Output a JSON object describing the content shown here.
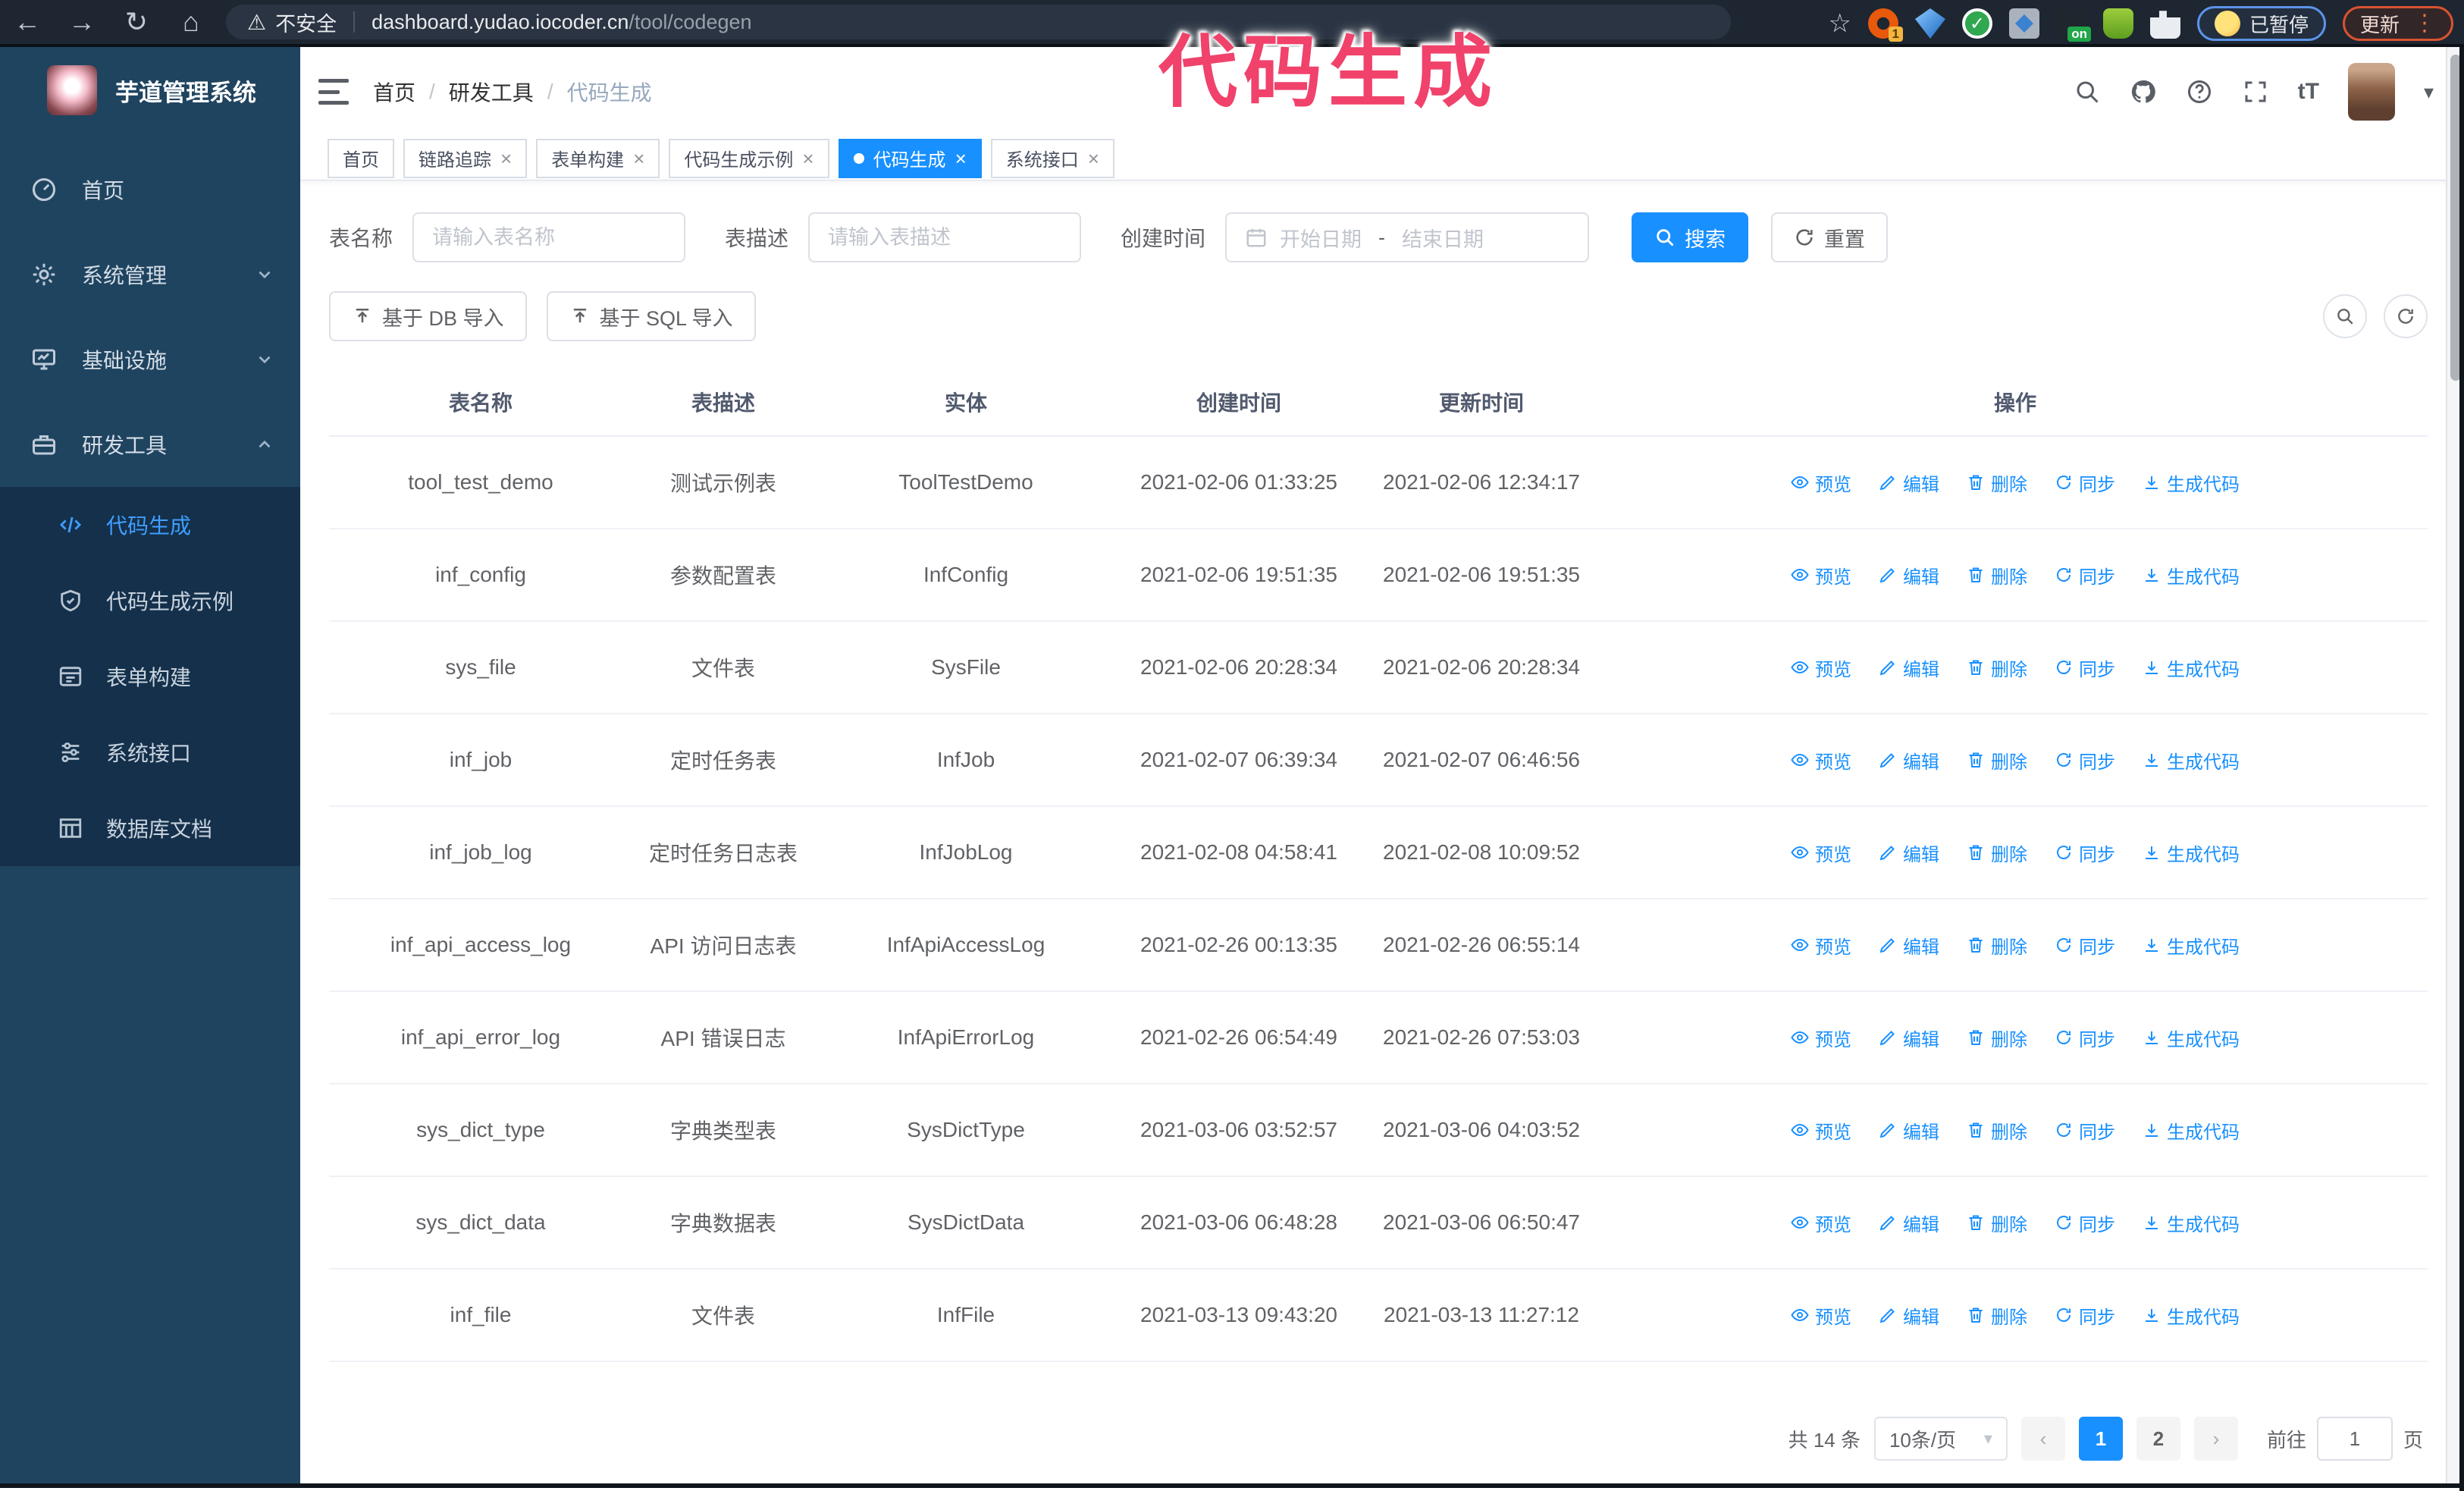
{
  "overlay": {
    "text": "代码生成",
    "color": "#f0426b"
  },
  "browser": {
    "insecure_label": "不安全",
    "url_host": "dashboard.yudao.iocoder.cn",
    "url_path": "/tool/codegen",
    "ext1_badge": "1",
    "ext5_badge": "on",
    "paused_label": "已暂停",
    "update_label": "更新"
  },
  "colors": {
    "primary": "#1890ff",
    "sidebar_bg": "#1f4460",
    "submenu_bg": "#14304b",
    "active_link": "#409eff"
  },
  "sidebar": {
    "title": "芋道管理系统",
    "items": [
      {
        "label": "首页",
        "icon": "dashboard-icon"
      },
      {
        "label": "系统管理",
        "icon": "gear-icon",
        "chevron": "down"
      },
      {
        "label": "基础设施",
        "icon": "monitor-icon",
        "chevron": "down"
      },
      {
        "label": "研发工具",
        "icon": "briefcase-icon",
        "chevron": "up"
      }
    ],
    "submenu": [
      {
        "label": "代码生成",
        "icon": "code-icon",
        "active": true
      },
      {
        "label": "代码生成示例",
        "icon": "shield-icon",
        "active": false
      },
      {
        "label": "表单构建",
        "icon": "form-icon",
        "active": false
      },
      {
        "label": "系统接口",
        "icon": "sliders-icon",
        "active": false
      },
      {
        "label": "数据库文档",
        "icon": "database-icon",
        "active": false
      }
    ]
  },
  "header": {
    "breadcrumb": [
      "首页",
      "研发工具",
      "代码生成"
    ]
  },
  "tabs": [
    {
      "label": "首页",
      "closable": false,
      "active": false
    },
    {
      "label": "链路追踪",
      "closable": true,
      "active": false
    },
    {
      "label": "表单构建",
      "closable": true,
      "active": false
    },
    {
      "label": "代码生成示例",
      "closable": true,
      "active": false
    },
    {
      "label": "代码生成",
      "closable": true,
      "active": true
    },
    {
      "label": "系统接口",
      "closable": true,
      "active": false
    }
  ],
  "filters": {
    "name_label": "表名称",
    "name_placeholder": "请输入表名称",
    "desc_label": "表描述",
    "desc_placeholder": "请输入表描述",
    "time_label": "创建时间",
    "start_placeholder": "开始日期",
    "range_separator": "-",
    "end_placeholder": "结束日期",
    "search_label": "搜索",
    "reset_label": "重置"
  },
  "toolbar": {
    "db_import_label": "基于 DB 导入",
    "sql_import_label": "基于 SQL 导入"
  },
  "table": {
    "columns": [
      "表名称",
      "表描述",
      "实体",
      "创建时间",
      "更新时间",
      "操作"
    ],
    "row_actions": [
      {
        "key": "preview",
        "label": "预览"
      },
      {
        "key": "edit",
        "label": "编辑"
      },
      {
        "key": "delete",
        "label": "删除"
      },
      {
        "key": "sync",
        "label": "同步"
      },
      {
        "key": "generate",
        "label": "生成代码"
      }
    ],
    "rows": [
      {
        "name": "tool_test_demo",
        "desc": "测试示例表",
        "entity": "ToolTestDemo",
        "created": "2021-02-06 01:33:25",
        "updated": "2021-02-06 12:34:17"
      },
      {
        "name": "inf_config",
        "desc": "参数配置表",
        "entity": "InfConfig",
        "created": "2021-02-06 19:51:35",
        "updated": "2021-02-06 19:51:35"
      },
      {
        "name": "sys_file",
        "desc": "文件表",
        "entity": "SysFile",
        "created": "2021-02-06 20:28:34",
        "updated": "2021-02-06 20:28:34"
      },
      {
        "name": "inf_job",
        "desc": "定时任务表",
        "entity": "InfJob",
        "created": "2021-02-07 06:39:34",
        "updated": "2021-02-07 06:46:56"
      },
      {
        "name": "inf_job_log",
        "desc": "定时任务日志表",
        "entity": "InfJobLog",
        "created": "2021-02-08 04:58:41",
        "updated": "2021-02-08 10:09:52"
      },
      {
        "name": "inf_api_access_log",
        "desc": "API 访问日志表",
        "entity": "InfApiAccessLog",
        "created": "2021-02-26 00:13:35",
        "updated": "2021-02-26 06:55:14"
      },
      {
        "name": "inf_api_error_log",
        "desc": "API 错误日志",
        "entity": "InfApiErrorLog",
        "created": "2021-02-26 06:54:49",
        "updated": "2021-02-26 07:53:03"
      },
      {
        "name": "sys_dict_type",
        "desc": "字典类型表",
        "entity": "SysDictType",
        "created": "2021-03-06 03:52:57",
        "updated": "2021-03-06 04:03:52"
      },
      {
        "name": "sys_dict_data",
        "desc": "字典数据表",
        "entity": "SysDictData",
        "created": "2021-03-06 06:48:28",
        "updated": "2021-03-06 06:50:47"
      },
      {
        "name": "inf_file",
        "desc": "文件表",
        "entity": "InfFile",
        "created": "2021-03-13 09:43:20",
        "updated": "2021-03-13 11:27:12"
      }
    ]
  },
  "pagination": {
    "total": "共 14 条",
    "page_size": "10条/页",
    "prev": "‹",
    "next": "›",
    "pages": [
      "1",
      "2"
    ],
    "active_page": "1",
    "goto_label": "前往",
    "goto_value": "1",
    "page_unit": "页"
  }
}
